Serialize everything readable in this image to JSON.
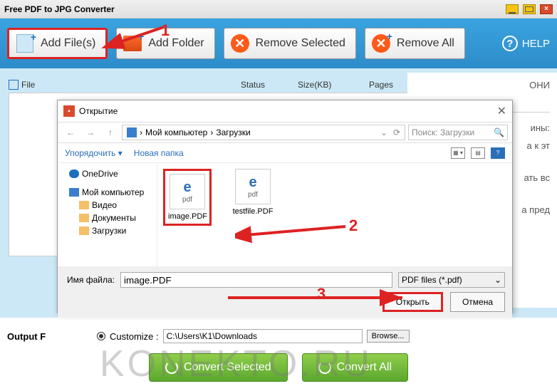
{
  "window": {
    "title": "Free PDF to JPG Converter"
  },
  "toolbar": {
    "addFiles": "Add File(s)",
    "addFolder": "Add Folder",
    "removeSelected": "Remove Selected",
    "removeAll": "Remove All",
    "help": "HELP"
  },
  "columns": {
    "file": "File",
    "status": "Status",
    "size": "Size(KB)",
    "pages": "Pages"
  },
  "sidebar": {
    "t1": "ОНИ",
    "t2": "ины:",
    "t3": "а к эт",
    "t4": "ать вс",
    "t5": "а пред"
  },
  "dialog": {
    "title": "Открытие",
    "breadcrumb": {
      "root": "Мой компьютер",
      "sep": "›",
      "folder": "Загрузки"
    },
    "searchPlaceholder": "Поиск: Загрузки",
    "organize": "Упорядочить",
    "newFolder": "Новая папка",
    "tree": {
      "onedrive": "OneDrive",
      "computer": "Мой компьютер",
      "video": "Видео",
      "documents": "Документы",
      "downloads": "Загрузки"
    },
    "files": {
      "f1": "image.PDF",
      "f2": "testfile.PDF",
      "ext": "pdf"
    },
    "filenameLabel": "Имя файла:",
    "filenameValue": "image.PDF",
    "fileType": "PDF files (*.pdf)",
    "open": "Открыть",
    "cancel": "Отмена"
  },
  "output": {
    "label": "Output F",
    "customize": "Customize :",
    "path": "C:\\Users\\K1\\Downloads",
    "browse": "Browse..."
  },
  "convert": {
    "selected": "Convert Selected",
    "all": "Convert All"
  },
  "annotations": {
    "n1": "1",
    "n2": "2",
    "n3": "3"
  },
  "watermark": "KONEKTO.RU"
}
